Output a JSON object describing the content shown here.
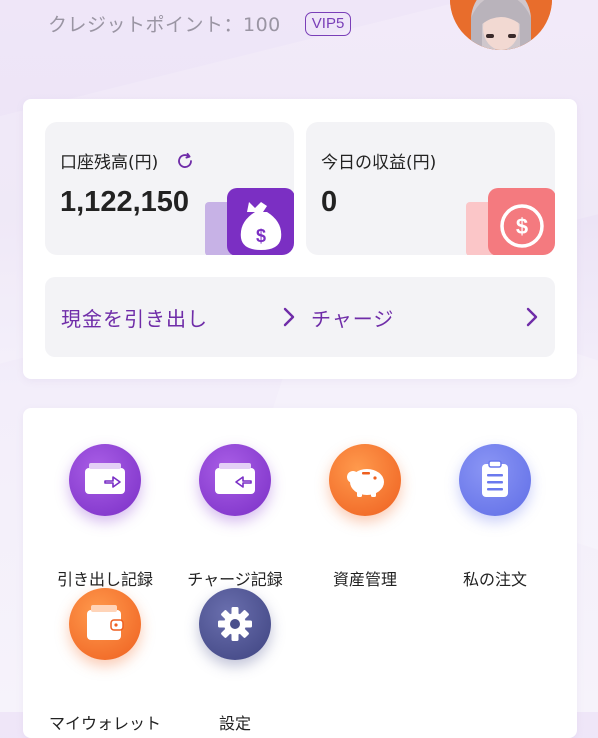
{
  "header": {
    "credit_text": "クレジットポイント：100",
    "vip_badge": "VIP5"
  },
  "balance": {
    "label": "口座残高(円)",
    "value": "1,122,150"
  },
  "income": {
    "label": "今日の収益(円)",
    "value": "0"
  },
  "actions": {
    "withdraw_label": "現金を引き出し",
    "charge_label": "チャージ"
  },
  "menu": {
    "items": [
      {
        "label": "引き出し記録",
        "icon": "wallet-out-icon",
        "color": "#8a3fd0"
      },
      {
        "label": "チャージ記録",
        "icon": "wallet-in-icon",
        "color": "#8a3fd0"
      },
      {
        "label": "資産管理",
        "icon": "piggy-bank-icon",
        "color": "#f06a28"
      },
      {
        "label": "私の注文",
        "icon": "clipboard-icon",
        "color": "#6b79ee"
      },
      {
        "label": "マイウォレット",
        "icon": "wallet-icon",
        "color": "#f06a28"
      },
      {
        "label": "設定",
        "icon": "gear-icon",
        "color": "#4a4f8c"
      }
    ]
  },
  "colors": {
    "accent_purple": "#6f2ca8",
    "orange": "#f06a28",
    "blue": "#6b79ee",
    "navy": "#4a4f8c",
    "pink": "#f47a7f"
  }
}
